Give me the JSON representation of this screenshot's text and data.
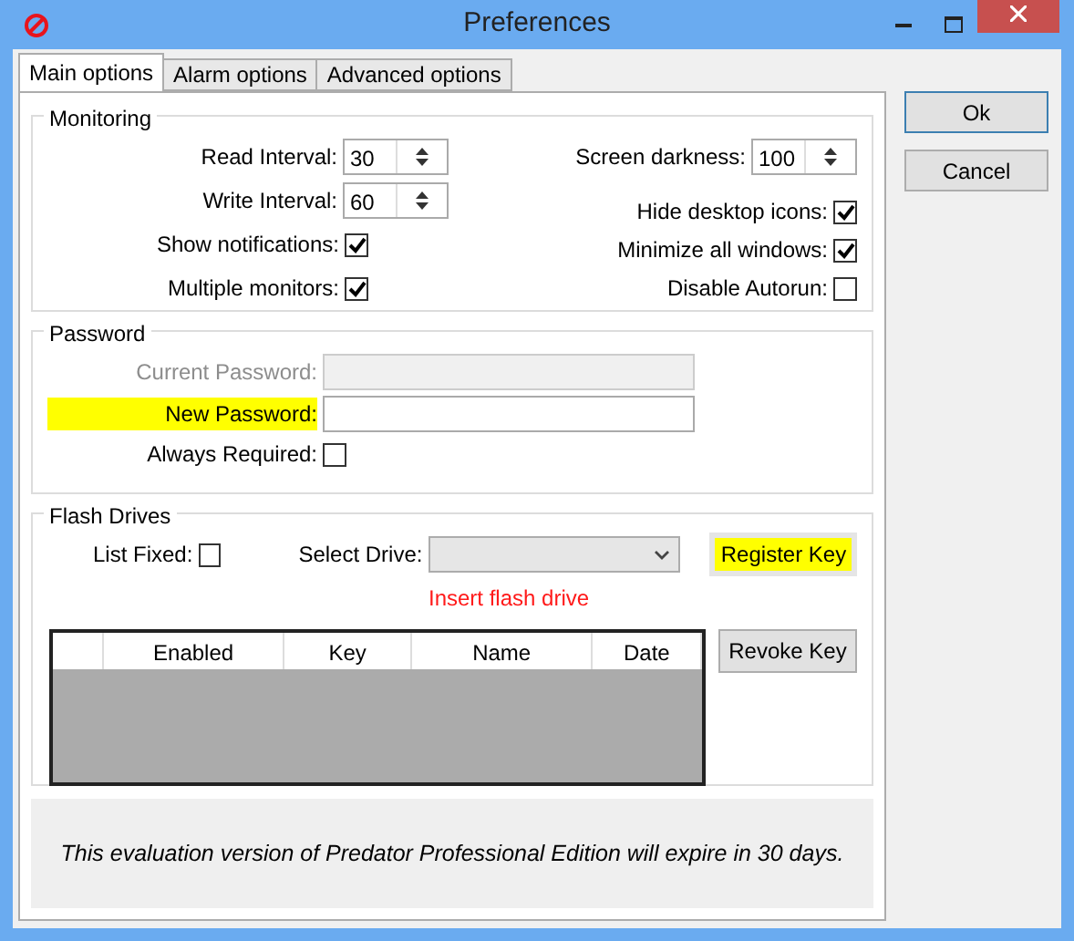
{
  "window": {
    "title": "Preferences"
  },
  "tabs": [
    {
      "label": "Main options",
      "selected": true
    },
    {
      "label": "Alarm options",
      "selected": false
    },
    {
      "label": "Advanced options",
      "selected": false
    }
  ],
  "monitoring": {
    "title": "Monitoring",
    "left": [
      {
        "kind": "spin",
        "label": "Read Interval:",
        "value": "30"
      },
      {
        "kind": "spin",
        "label": "Write Interval:",
        "value": "60"
      },
      {
        "kind": "check",
        "label": "Show notifications:",
        "checked": true
      },
      {
        "kind": "check",
        "label": "Multiple monitors:",
        "checked": true
      }
    ],
    "right": [
      {
        "kind": "spin",
        "label": "Screen darkness:",
        "value": "100"
      },
      {
        "kind": "check",
        "label": "Hide desktop icons:",
        "checked": true
      },
      {
        "kind": "check",
        "label": "Minimize all windows:",
        "checked": true
      },
      {
        "kind": "check",
        "label": "Disable Autorun:",
        "checked": false
      }
    ]
  },
  "password": {
    "title": "Password",
    "fields": [
      {
        "kind": "text",
        "label": "Current Password:",
        "disabled": true,
        "highlighted": false
      },
      {
        "kind": "text",
        "label": "New Password:",
        "disabled": false,
        "highlighted": true
      },
      {
        "kind": "check",
        "label": "Always Required:",
        "checked": false
      }
    ]
  },
  "flash_drives": {
    "title": "Flash Drives",
    "list_fixed": {
      "label": "List Fixed:",
      "checked": false
    },
    "select_drive": {
      "label": "Select Drive:"
    },
    "register_button": {
      "label": "Register Key",
      "highlighted": true
    },
    "message": "Insert flash drive",
    "table": {
      "columns": [
        "Enabled",
        "Key",
        "Name",
        "Date"
      ]
    },
    "revoke_button": {
      "label": "Revoke Key"
    }
  },
  "notice": "This evaluation version of Predator Professional Edition will expire in 30 days.",
  "buttons": [
    "Ok",
    "Cancel"
  ]
}
